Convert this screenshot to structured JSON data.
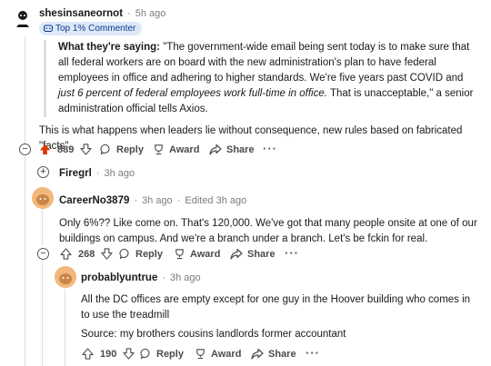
{
  "comment1": {
    "username": "shesinsaneornot",
    "time": "5h ago",
    "badge": "Top 1% Commenter",
    "quote_lead": "What they're saying:",
    "quote_text1": " \"The government-wide email being sent today is to make sure that all federal workers are on board with the new administration's plan to have federal employees in office and adhering to higher standards. We're five years past COVID and ",
    "quote_italic": "just 6 percent of federal employees work full-time in office.",
    "quote_text2": " That is unacceptable,\" a senior administration official tells Axios.",
    "body": "This is what happens when leaders lie without consequence, new rules based on fabricated \"facts\".",
    "votes": "889",
    "reply": "Reply",
    "award": "Award",
    "share": "Share",
    "more": "···",
    "collapse_symbol": "−",
    "upvote_color": "#d93a00"
  },
  "comment_collapsed": {
    "username": "Firegrl",
    "time": "3h ago",
    "expand_symbol": "+"
  },
  "comment2": {
    "username": "CareerNo3879",
    "time": "3h ago",
    "edited": "Edited 3h ago",
    "body": "Only 6%?? Like come on. That's 120,000. We've got that many people onsite at one of our buildings on campus. And we're a branch under a branch. Let's be fckin for real.",
    "votes": "268",
    "reply": "Reply",
    "award": "Award",
    "share": "Share",
    "more": "···",
    "collapse_symbol": "−"
  },
  "comment3": {
    "username": "probablyuntrue",
    "time": "3h ago",
    "body1": "All the DC offices are empty except for one guy in the Hoover building who comes in to use the treadmill",
    "body2": "Source: my brothers cousins landlords former accountant",
    "votes": "190",
    "reply": "Reply",
    "award": "Award",
    "share": "Share",
    "more": "···"
  },
  "separator": "·"
}
